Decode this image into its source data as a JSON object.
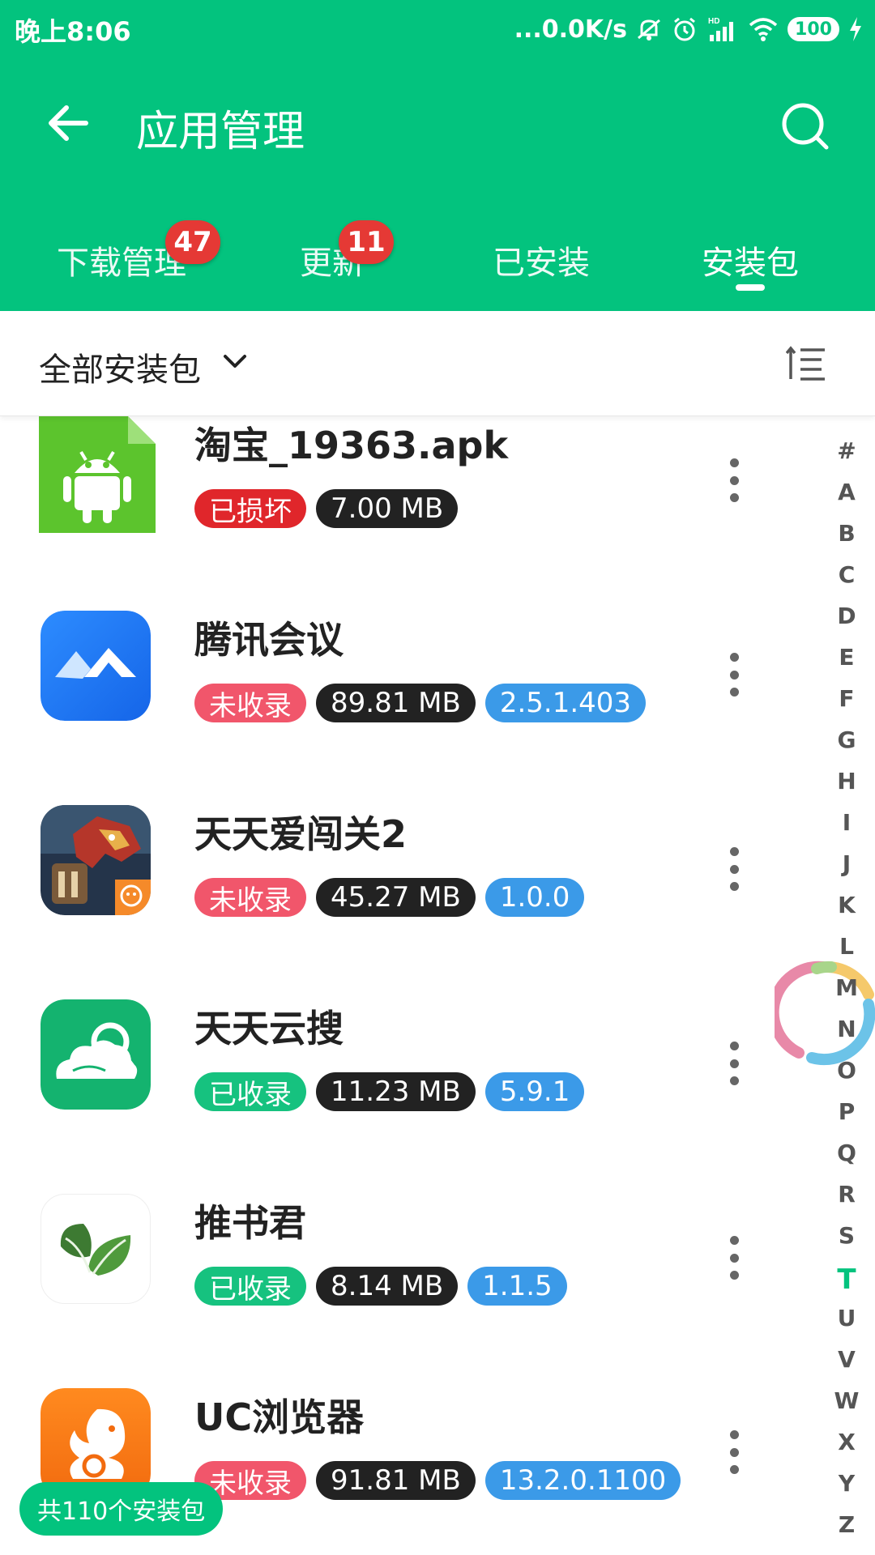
{
  "status_bar": {
    "time": "晚上8:06",
    "net_speed": "...0.0K/s",
    "battery": "100",
    "icons": [
      "mute-icon",
      "alarm-icon",
      "signal-hd-icon",
      "wifi-icon",
      "battery-icon",
      "charging-icon"
    ]
  },
  "appbar": {
    "title": "应用管理",
    "back_icon": "arrow-left-icon",
    "search_icon": "search-icon"
  },
  "tabs": [
    {
      "label": "下载管理",
      "badge": "47"
    },
    {
      "label": "更新",
      "badge": "11"
    },
    {
      "label": "已安装",
      "badge": ""
    },
    {
      "label": "安装包",
      "badge": "",
      "active": true
    }
  ],
  "filter": {
    "label": "全部安装包",
    "chevron_icon": "chevron-down-icon",
    "sort_icon": "sort-icon"
  },
  "colors": {
    "brand": "#03c37e",
    "tag_red": "#e0262b",
    "tag_pink": "#f1566b",
    "tag_green": "#16c27f",
    "tag_black": "#222222",
    "tag_blue": "#3b9ae8"
  },
  "apps": [
    {
      "name": "淘宝_19363.apk",
      "status": "已损坏",
      "status_color": "#e0262b",
      "size": "7.00 MB",
      "version": "",
      "icon": "android-file-icon"
    },
    {
      "name": "腾讯会议",
      "status": "未收录",
      "status_color": "#f1566b",
      "size": "89.81 MB",
      "version": "2.5.1.403",
      "icon": "tencent-meeting-icon"
    },
    {
      "name": "天天爱闯关2",
      "status": "未收录",
      "status_color": "#f1566b",
      "size": "45.27 MB",
      "version": "1.0.0",
      "icon": "game-dragon-icon"
    },
    {
      "name": "天天云搜",
      "status": "已收录",
      "status_color": "#16c27f",
      "size": "11.23 MB",
      "version": "5.9.1",
      "icon": "cloud-search-icon"
    },
    {
      "name": "推书君",
      "status": "已收录",
      "status_color": "#16c27f",
      "size": "8.14 MB",
      "version": "1.1.5",
      "icon": "leaf-icon"
    },
    {
      "name": "UC浏览器",
      "status": "未收录",
      "status_color": "#f1566b",
      "size": "91.81 MB",
      "version": "13.2.0.1100",
      "icon": "uc-squirrel-icon"
    }
  ],
  "alpha_index": {
    "letters": [
      "#",
      "A",
      "B",
      "C",
      "D",
      "E",
      "F",
      "G",
      "H",
      "I",
      "J",
      "K",
      "L",
      "M",
      "N",
      "O",
      "P",
      "Q",
      "R",
      "S",
      "T",
      "U",
      "V",
      "W",
      "X",
      "Y",
      "Z"
    ],
    "active": "T",
    "active_color": "#03c37e"
  },
  "footer": {
    "count_label": "共110个安装包"
  }
}
